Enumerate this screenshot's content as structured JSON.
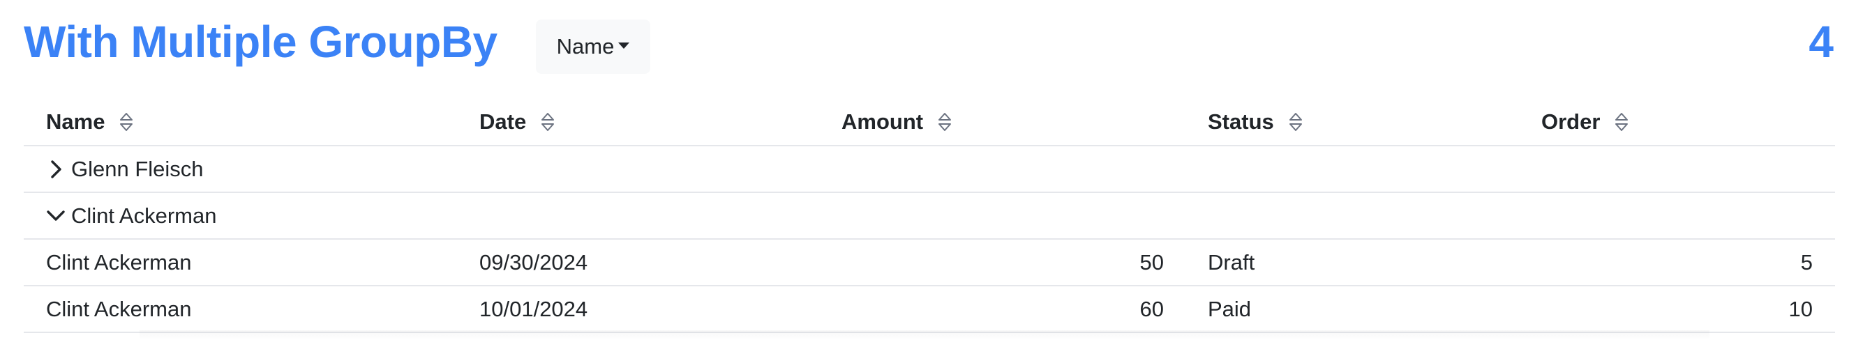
{
  "header": {
    "title": "With Multiple GroupBy",
    "groupby_dropdown_label": "Name",
    "count": "4"
  },
  "table": {
    "columns": [
      {
        "label": "Name"
      },
      {
        "label": "Date"
      },
      {
        "label": "Amount"
      },
      {
        "label": "Status"
      },
      {
        "label": "Order"
      }
    ],
    "groups": [
      {
        "label": "Glenn Fleisch",
        "expanded": false
      },
      {
        "label": "Clint Ackerman",
        "expanded": true
      }
    ],
    "rows": [
      {
        "name": "Clint Ackerman",
        "date": "09/30/2024",
        "amount": "50",
        "status": "Draft",
        "order": "5"
      },
      {
        "name": "Clint Ackerman",
        "date": "10/01/2024",
        "amount": "60",
        "status": "Paid",
        "order": "10"
      }
    ]
  },
  "icons": {
    "sort": "sort-updown-icon",
    "collapsed": "chevron-right-icon",
    "expanded": "chevron-down-icon"
  },
  "colors": {
    "accent": "#3b82f6",
    "row_border": "#e5e7eb",
    "button_bg": "#f8f9fa"
  }
}
